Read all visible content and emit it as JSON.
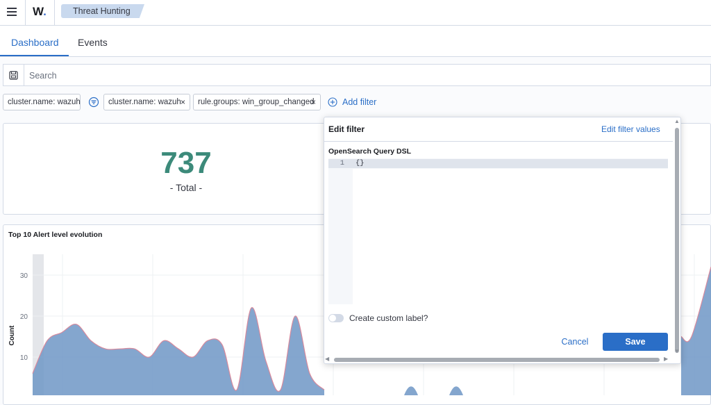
{
  "header": {
    "logo_text": "W",
    "logo_dot": ".",
    "breadcrumb": "Threat Hunting"
  },
  "tabs": [
    {
      "label": "Dashboard",
      "active": true
    },
    {
      "label": "Events",
      "active": false
    }
  ],
  "search": {
    "placeholder": "Search",
    "value": ""
  },
  "filters": {
    "pinned": "cluster.name: wazuh",
    "items": [
      {
        "label": "cluster.name: wazuh",
        "remove": "×"
      },
      {
        "label": "rule.groups: win_group_changed",
        "remove": "×"
      }
    ],
    "add_label": "Add filter"
  },
  "metric": {
    "value": "737",
    "label": "- Total -"
  },
  "chart_data": {
    "type": "area",
    "title": "Top 10 Alert level evolution",
    "ylabel": "Count",
    "xlabel": "",
    "y_ticks": [
      10,
      20,
      30
    ],
    "ylim": [
      0,
      35
    ],
    "grid": true,
    "values": [
      6,
      14,
      16,
      18,
      14,
      12,
      12,
      12,
      10,
      14,
      12,
      10,
      14,
      13,
      2,
      22,
      9,
      2,
      20,
      6,
      2
    ],
    "values_right": [
      15,
      15,
      32
    ],
    "color": "#6f97c6"
  },
  "edit_filter": {
    "title": "Edit filter",
    "edit_values_link": "Edit filter values",
    "dsl_label": "OpenSearch Query DSL",
    "line_number": "1",
    "content": "{}",
    "custom_label": "Create custom label?",
    "cancel_label": "Cancel",
    "save_label": "Save"
  },
  "colors": {
    "accent": "#2a6ec7",
    "metric": "#3c8a7a",
    "chart_fill": "#6f97c6"
  }
}
